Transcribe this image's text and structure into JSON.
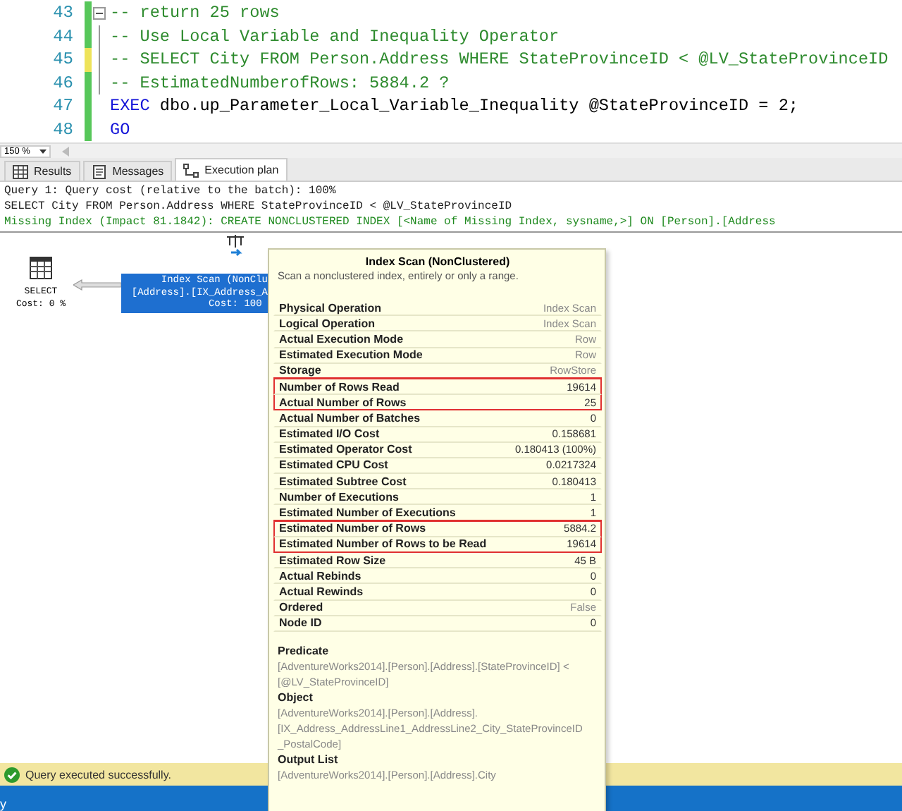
{
  "editor": {
    "lines": [
      {
        "number": "43",
        "unsaved": false,
        "fold": true,
        "segments": [
          {
            "text": "-- return 25 rows",
            "kind": "comment"
          }
        ]
      },
      {
        "number": "44",
        "unsaved": false,
        "fold": false,
        "segments": [
          {
            "text": "-- Use Local Variable and Inequality Operator",
            "kind": "comment"
          }
        ]
      },
      {
        "number": "45",
        "unsaved": true,
        "fold": false,
        "segments": [
          {
            "text": "-- SELECT City FROM Person.Address WHERE StateProvinceID < @LV_StateProvinceID",
            "kind": "comment"
          }
        ]
      },
      {
        "number": "46",
        "unsaved": false,
        "fold": false,
        "segments": [
          {
            "text": "-- EstimatedNumberofRows: 5884.2 ?",
            "kind": "comment"
          }
        ]
      },
      {
        "number": "47",
        "unsaved": false,
        "fold": false,
        "segments": [
          {
            "text": "EXEC",
            "kind": "keyword"
          },
          {
            "text": " dbo.up_Parameter_Local_Variable_Inequality @StateProvinceID = 2;",
            "kind": "plain"
          }
        ]
      },
      {
        "number": "48",
        "unsaved": false,
        "fold": false,
        "segments": [
          {
            "text": "GO",
            "kind": "keyword"
          }
        ]
      }
    ]
  },
  "zoom": "150 %",
  "tabs": [
    {
      "label": "Results",
      "selected": false
    },
    {
      "label": "Messages",
      "selected": false
    },
    {
      "label": "Execution plan",
      "selected": true
    }
  ],
  "plan": {
    "header": [
      {
        "text": "Query 1: Query cost (relative to the batch): 100%",
        "kind": "plain"
      },
      {
        "text": "SELECT City FROM Person.Address WHERE StateProvinceID < @LV_StateProvinceID",
        "kind": "plain"
      },
      {
        "text": "Missing Index (Impact 81.1842): CREATE NONCLUSTERED INDEX [<Name of Missing Index, sysname,>] ON [Person].[Address",
        "kind": "hint"
      }
    ],
    "select_node": {
      "label": "SELECT",
      "cost": "Cost: 0 %"
    },
    "scan_node": {
      "lines": [
        "Index Scan (NonClu",
        "[Address].[IX_Address_A",
        "Cost: 100 "
      ],
      "selected": true
    }
  },
  "tooltip": {
    "title": "Index Scan (NonClustered)",
    "description": "Scan a nonclustered index, entirely or only a range.",
    "properties": [
      {
        "name": "Physical Operation",
        "value": "Index Scan",
        "kind": "text",
        "highlighted": false
      },
      {
        "name": "Logical Operation",
        "value": "Index Scan",
        "kind": "text",
        "highlighted": false
      },
      {
        "name": "Actual Execution Mode",
        "value": "Row",
        "kind": "text",
        "highlighted": false
      },
      {
        "name": "Estimated Execution Mode",
        "value": "Row",
        "kind": "text",
        "highlighted": false
      },
      {
        "name": "Storage",
        "value": "RowStore",
        "kind": "text",
        "highlighted": false
      },
      {
        "name": "Number of Rows Read",
        "value": "19614",
        "kind": "number",
        "highlighted": true
      },
      {
        "name": "Actual Number of Rows",
        "value": "25",
        "kind": "number",
        "highlighted": true
      },
      {
        "name": "Actual Number of Batches",
        "value": "0",
        "kind": "number",
        "highlighted": false
      },
      {
        "name": "Estimated I/O Cost",
        "value": "0.158681",
        "kind": "number",
        "highlighted": false
      },
      {
        "name": "Estimated Operator Cost",
        "value": "0.180413 (100%)",
        "kind": "number",
        "highlighted": false
      },
      {
        "name": "Estimated CPU Cost",
        "value": "0.0217324",
        "kind": "number",
        "highlighted": false
      },
      {
        "name": "Estimated Subtree Cost",
        "value": "0.180413",
        "kind": "number",
        "highlighted": false
      },
      {
        "name": "Number of Executions",
        "value": "1",
        "kind": "number",
        "highlighted": false
      },
      {
        "name": "Estimated Number of Executions",
        "value": "1",
        "kind": "number",
        "highlighted": false
      },
      {
        "name": "Estimated Number of Rows",
        "value": "5884.2",
        "kind": "number",
        "highlighted": true
      },
      {
        "name": "Estimated Number of Rows to be Read",
        "value": "19614",
        "kind": "number",
        "highlighted": true
      },
      {
        "name": "Estimated Row Size",
        "value": "45 B",
        "kind": "number",
        "highlighted": false
      },
      {
        "name": "Actual Rebinds",
        "value": "0",
        "kind": "number",
        "highlighted": false
      },
      {
        "name": "Actual Rewinds",
        "value": "0",
        "kind": "number",
        "highlighted": false
      },
      {
        "name": "Ordered",
        "value": "False",
        "kind": "text",
        "highlighted": false
      },
      {
        "name": "Node ID",
        "value": "0",
        "kind": "number",
        "highlighted": false
      }
    ],
    "details": [
      {
        "label": "Predicate",
        "value": "[AdventureWorks2014].[Person].[Address].[StateProvinceID] < [@LV_StateProvinceID]"
      },
      {
        "label": "Object",
        "value": "[AdventureWorks2014].[Person].[Address].[IX_Address_AddressLine1_AddressLine2_City_StateProvinceID _PostalCode]"
      },
      {
        "label": "Output List",
        "value": "[AdventureWorks2014].[Person].[Address].City"
      }
    ]
  },
  "status_bar": {
    "message": "Query executed successfully."
  },
  "bottom_bar": {
    "text": "y"
  }
}
